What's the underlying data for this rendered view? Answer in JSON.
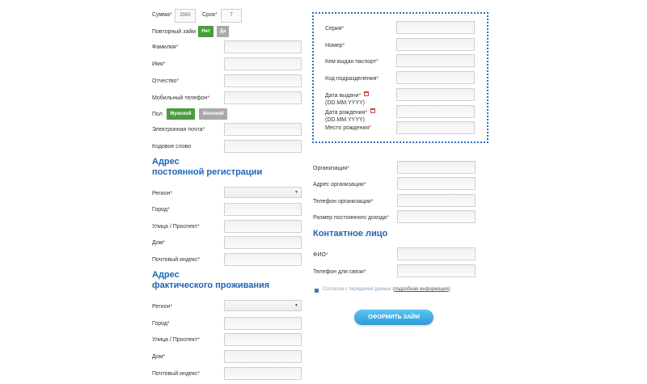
{
  "top": {
    "sum_label": "Сумма",
    "sum_value": "2000",
    "term_label": "Срок",
    "term_value": "7",
    "repeat_loan_label": "Повторный займ",
    "repeat_no": "Нет",
    "repeat_yes": "Да"
  },
  "personal": {
    "surname": "Фамилия",
    "name": "Имя",
    "patronymic": "Отчество",
    "mobile": "Мобильный телефон",
    "gender_label": "Пол",
    "gender_male": "Мужской",
    "gender_female": "Женский",
    "email": "Электронная почта",
    "code_word": "Кодовое слово"
  },
  "req_mark": "*",
  "registration": {
    "heading_line1": "Адрес",
    "heading_line2": "постоянной регистрации",
    "region": "Регион",
    "city": "Город",
    "street": "Улица / Проспект",
    "house": "Дом",
    "postcode": "Почтовый индекс"
  },
  "actual": {
    "heading_line1": "Адрес",
    "heading_line2": "фактического проживания",
    "region": "Регион",
    "city": "Город",
    "street": "Улица / Проспект",
    "house": "Дом",
    "postcode": "Почтовый индекс"
  },
  "passport": {
    "series": "Серия",
    "number": "Номер",
    "issued_by": "Кем выдан паспорт",
    "dept_code": "Код подразделения",
    "issue_date": "Дата выдачи",
    "issue_date_fmt": "(DD.MM.YYYY)",
    "birth_date": "Дата рождения",
    "birth_date_fmt": "(DD.MM.YYYY)",
    "birth_place": "Место рождения"
  },
  "work": {
    "organization": "Организация",
    "org_address": "Адрес организации",
    "org_phone": "Телефон организации",
    "income": "Размер постоянного дохода"
  },
  "contact": {
    "heading": "Контактное лицо",
    "fio": "ФИО",
    "phone": "Телефон для связи"
  },
  "consent": {
    "text": "Согласен с передачей данных",
    "link": "подробная информация",
    "open": "(",
    "close": ")"
  },
  "submit_label": "ОФОРМИТЬ ЗАЙМ",
  "colors": {
    "accent_blue": "#1f64b8",
    "green_button": "#4a9c3e",
    "grey_button": "#a9a9a9",
    "submit_gradient_top": "#5cc5f1",
    "submit_gradient_bottom": "#2f9ad9",
    "required": "#d22222"
  }
}
